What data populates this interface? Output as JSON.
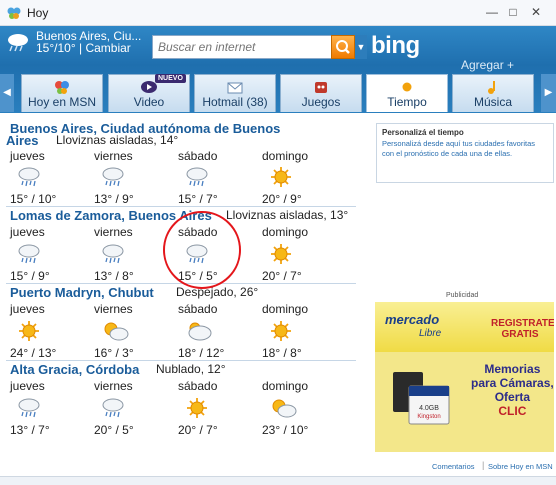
{
  "window": {
    "title": "Hoy"
  },
  "header": {
    "location_short": "Buenos Aires, Ciu...",
    "temps_short": "15°/10°",
    "change_label": "Cambiar",
    "search_placeholder": "Buscar en internet",
    "bing_label": "bing",
    "agregar_label": "Agregar +"
  },
  "tabs": [
    {
      "label": "Hoy en MSN"
    },
    {
      "label": "Video",
      "badge": "NUEVO"
    },
    {
      "label": "Hotmail (38)"
    },
    {
      "label": "Juegos"
    },
    {
      "label": "Tiempo"
    },
    {
      "label": "Música"
    }
  ],
  "side_panel": {
    "title": "Personalizá el tiempo",
    "text": "Personalizá desde aquí tus ciudades favoritas con el pronóstico de cada una de ellas."
  },
  "cities": [
    {
      "name": "Buenos Aires, Ciudad autónoma de Buenos Aires",
      "name_line1": "Buenos Aires, Ciudad autónoma de Buenos",
      "name_line2": "Aires",
      "condition": "Lloviznas aisladas, 14°",
      "days": [
        {
          "day": "jueves",
          "icon": "rain",
          "temps": "15° / 10°"
        },
        {
          "day": "viernes",
          "icon": "rain",
          "temps": "13° / 9°"
        },
        {
          "day": "sábado",
          "icon": "rain",
          "temps": "15° / 7°"
        },
        {
          "day": "domingo",
          "icon": "sun",
          "temps": "20° / 9°"
        }
      ]
    },
    {
      "name": "Lomas de Zamora, Buenos Aires",
      "condition": "Lloviznas aisladas, 13°",
      "days": [
        {
          "day": "jueves",
          "icon": "rain",
          "temps": "15° / 9°"
        },
        {
          "day": "viernes",
          "icon": "rain",
          "temps": "13° / 8°"
        },
        {
          "day": "sábado",
          "icon": "rain",
          "temps": "15° / 5°"
        },
        {
          "day": "domingo",
          "icon": "sun",
          "temps": "20° / 7°"
        }
      ]
    },
    {
      "name": "Puerto Madryn, Chubut",
      "condition": "Despejado, 26°",
      "days": [
        {
          "day": "jueves",
          "icon": "sun",
          "temps": "24° / 13°"
        },
        {
          "day": "viernes",
          "icon": "partly-cloudy",
          "temps": "16° / 3°"
        },
        {
          "day": "sábado",
          "icon": "cloudy",
          "temps": "18° / 12°"
        },
        {
          "day": "domingo",
          "icon": "sun",
          "temps": "18° / 8°"
        }
      ]
    },
    {
      "name": "Alta Gracia, Córdoba",
      "condition": "Nublado, 12°",
      "days": [
        {
          "day": "jueves",
          "icon": "rain",
          "temps": "13° / 7°"
        },
        {
          "day": "viernes",
          "icon": "rain",
          "temps": "20° / 5°"
        },
        {
          "day": "sábado",
          "icon": "sun",
          "temps": "20° / 7°"
        },
        {
          "day": "domingo",
          "icon": "partly-cloudy",
          "temps": "23° / 10°"
        }
      ]
    }
  ],
  "ad": {
    "label": "Publicidad",
    "brand": "mercado",
    "brand2": "Libre",
    "register": "REGISTRATE GRATIS",
    "line1": "Memorias",
    "line2": "para Cámaras,",
    "line3": "Oferta",
    "line4": "CLIC",
    "card_label": "Kingston",
    "card_size": "4.0GB"
  },
  "footer": {
    "comments": "Comentarios",
    "about": "Sobre Hoy en MSN"
  },
  "colors": {
    "header_blue": "#1f6fae",
    "city_blue": "#1a5c9a",
    "sun": "#f2a20c",
    "highlight_circle": "#e4161b"
  }
}
